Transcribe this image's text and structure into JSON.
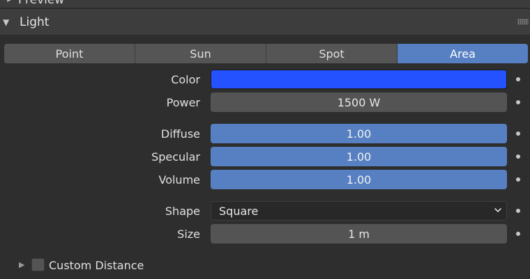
{
  "preview_panel": {
    "title": "Preview",
    "expand_icon": "triangle-right"
  },
  "light_panel": {
    "title": "Light",
    "expand_icon": "triangle-down",
    "grip_icon": "drag-grip-dots"
  },
  "light_type": {
    "options": [
      "Point",
      "Sun",
      "Spot",
      "Area"
    ],
    "selected": "Area"
  },
  "properties": {
    "color": {
      "label": "Color",
      "value_hex": "#2452ff"
    },
    "power": {
      "label": "Power",
      "value": "1500 W"
    },
    "diffuse": {
      "label": "Diffuse",
      "value": "1.00"
    },
    "specular": {
      "label": "Specular",
      "value": "1.00"
    },
    "volume": {
      "label": "Volume",
      "value": "1.00"
    },
    "shape": {
      "label": "Shape",
      "value": "Square",
      "icon": "chevron-down"
    },
    "size": {
      "label": "Size",
      "value": "1 m"
    }
  },
  "custom_distance": {
    "label": "Custom Distance",
    "checked": false,
    "expand_icon": "triangle-right"
  },
  "colors": {
    "accent": "#5680c2",
    "panel_bg": "#2e2e2e",
    "header_bg": "#3d3d3d",
    "field_bg": "#545454"
  }
}
